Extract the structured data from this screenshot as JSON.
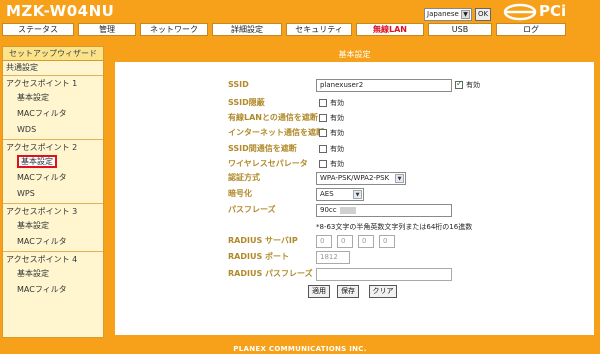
{
  "header": {
    "model": "MZK-W04NU",
    "language": "Japanese",
    "ok_label": "OK",
    "logo_text": "PCi"
  },
  "menu": {
    "items": [
      {
        "label": "ステータス",
        "active": false
      },
      {
        "label": "管理",
        "active": false
      },
      {
        "label": "ネットワーク",
        "active": false
      },
      {
        "label": "詳細設定",
        "active": false
      },
      {
        "label": "セキュリティ",
        "active": false
      },
      {
        "label": "無線LAN",
        "active": true
      },
      {
        "label": "USB",
        "active": false
      },
      {
        "label": "ログ",
        "active": false
      }
    ]
  },
  "sidebar": {
    "head": "セットアップウィザード",
    "items": [
      {
        "label": "共通設定"
      },
      {
        "label": "アクセスポイント 1"
      },
      {
        "label": "基本設定"
      },
      {
        "label": "MACフィルタ"
      },
      {
        "label": "WDS"
      },
      {
        "label": "アクセスポイント 2"
      },
      {
        "label": "基本設定"
      },
      {
        "label": "MACフィルタ"
      },
      {
        "label": "WPS"
      },
      {
        "label": "アクセスポイント 3"
      },
      {
        "label": "基本設定"
      },
      {
        "label": "MACフィルタ"
      },
      {
        "label": "アクセスポイント 4"
      },
      {
        "label": "基本設定"
      },
      {
        "label": "MACフィルタ"
      }
    ]
  },
  "form": {
    "title": "基本設定",
    "ssid_label": "SSID",
    "ssid_value": "planexuser2",
    "ssid_enabled_label": "有効",
    "ssid_hide_label": "SSID隠蔽",
    "ssid_hide_opt": "有効",
    "wired_block_label": "有線LANとの通信を遮断",
    "wired_block_opt": "有効",
    "internet_block_label": "インターネット通信を遮断",
    "internet_block_opt": "有効",
    "ssid_between_label": "SSID間通信を遮断",
    "ssid_between_opt": "有効",
    "separator_label": "ワイヤレスセパレータ",
    "separator_opt": "有効",
    "auth_label": "認証方式",
    "auth_value": "WPA-PSK/WPA2-PSK",
    "enc_label": "暗号化",
    "enc_value": "AES",
    "pass_label": "パスフレーズ",
    "pass_value": "90cc",
    "pass_note": "*8-63文字の半角英数文字列または64桁の16進数",
    "radius_ip_label": "RADIUS サーバIP",
    "radius_ip": [
      "0",
      "0",
      "0",
      "0"
    ],
    "radius_port_label": "RADIUS ポート",
    "radius_port": "1812",
    "radius_pass_label": "RADIUS パスフレーズ",
    "radius_pass": "",
    "apply_label": "適用",
    "save_label": "保存",
    "clear_label": "クリア"
  },
  "footer": "PLANEX COMMUNICATIONS INC.",
  "colors": {
    "accent": "#f7a11a",
    "label": "#b08a2a",
    "active_tab": "#e0101f",
    "sidebar_bg": "#fff6d0"
  }
}
